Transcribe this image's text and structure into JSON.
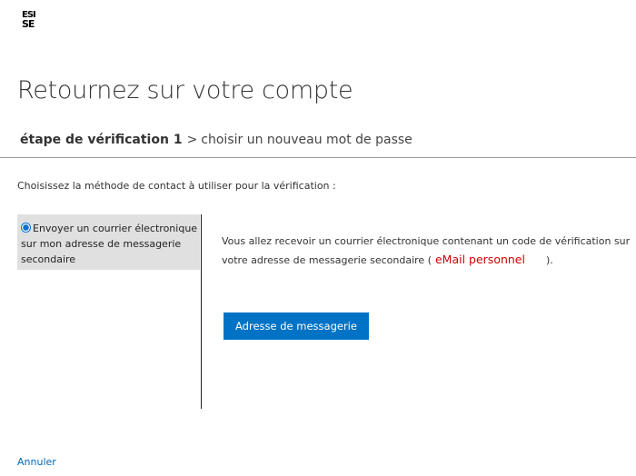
{
  "logo": {
    "line1": "ESI",
    "line2": "SE",
    "sub": ""
  },
  "page": {
    "title": "Retournez sur votre compte"
  },
  "steps": {
    "current": "étape de vérification 1",
    "separator": ">",
    "next": "choisir un nouveau mot de passe"
  },
  "instruction": "Choisissez la méthode de contact à utiliser pour la vérification :",
  "methods": [
    {
      "label": "Envoyer un courrier électronique sur mon adresse de messagerie secondaire",
      "selected": true
    }
  ],
  "description": {
    "before": "Vous allez recevoir un courrier électronique contenant un code de vérification sur votre adresse de messagerie secondaire (",
    "email": "eMail personnel",
    "after": ")."
  },
  "button": {
    "label": "Adresse de messagerie"
  },
  "cancel": "Annuler",
  "colors": {
    "accent": "#0073c6",
    "link": "#0067b8",
    "email_highlight": "#d10000",
    "selected_bg": "#e0e0e0"
  }
}
